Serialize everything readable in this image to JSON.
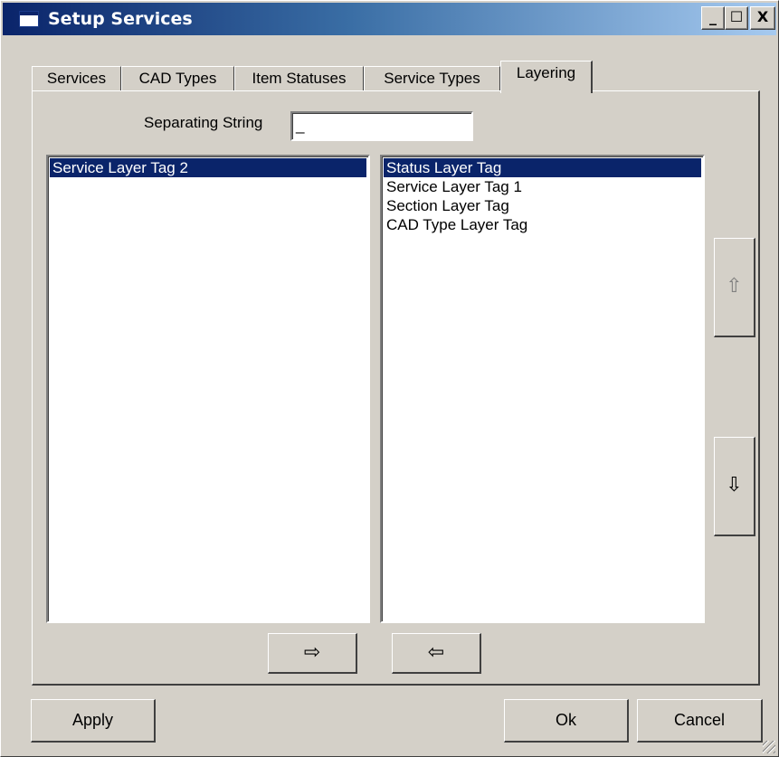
{
  "window": {
    "title": "Setup Services",
    "minimize_glyph": "_",
    "maximize_glyph": "☐",
    "close_glyph": "X"
  },
  "tabs": [
    {
      "label": "Services"
    },
    {
      "label": "CAD Types"
    },
    {
      "label": "Item Statuses"
    },
    {
      "label": "Service Types"
    },
    {
      "label": "Layering",
      "active": true
    }
  ],
  "layering": {
    "separating_string_label": "Separating String",
    "separating_string_value": "_",
    "available_tags": [
      "Service Layer Tag 2"
    ],
    "available_selected": "Service Layer Tag 2",
    "used_tags": [
      "Status Layer Tag",
      "Service Layer Tag 1",
      "Section Layer Tag",
      "CAD Type Layer Tag"
    ],
    "used_selected": "Status Layer Tag",
    "move_up_glyph": "⇧",
    "move_down_glyph": "⇩",
    "add_glyph": "⇨",
    "remove_glyph": "⇦"
  },
  "footer": {
    "apply_label": "Apply",
    "ok_label": "Ok",
    "cancel_label": "Cancel"
  },
  "colors": {
    "selection": "#0a246a",
    "face": "#d4d0c8",
    "title_start": "#0a246a",
    "title_end": "#a6caf0"
  }
}
